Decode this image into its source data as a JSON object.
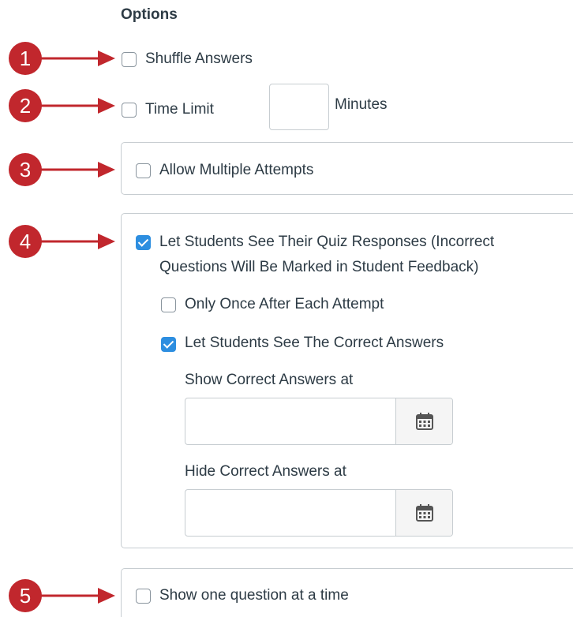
{
  "section": {
    "title": "Options"
  },
  "options": {
    "shuffle_answers": {
      "label": "Shuffle Answers",
      "checked": false
    },
    "time_limit": {
      "label": "Time Limit",
      "checked": false,
      "value": "",
      "unit_label": "Minutes"
    },
    "allow_multiple_attempts": {
      "label": "Allow Multiple Attempts",
      "checked": false
    },
    "see_responses": {
      "label_line1": "Let Students See Their Quiz Responses (Incorrect",
      "label_line2": "Questions Will Be Marked in Student Feedback)",
      "checked": true,
      "only_once": {
        "label": "Only Once After Each Attempt",
        "checked": false
      },
      "see_correct": {
        "label": "Let Students See The Correct Answers",
        "checked": true
      },
      "show_correct_at": {
        "label": "Show Correct Answers at",
        "value": ""
      },
      "hide_correct_at": {
        "label": "Hide Correct Answers at",
        "value": ""
      }
    },
    "one_question": {
      "label": "Show one question at a time",
      "checked": false
    }
  },
  "callouts": [
    "1",
    "2",
    "3",
    "4",
    "5"
  ],
  "colors": {
    "callout": "#c1272d",
    "checkbox_checked": "#2d8ee0",
    "text": "#2d3b45",
    "border": "#c7cdd1"
  },
  "icons": {
    "calendar": "calendar-icon",
    "checkmark": "checkmark-icon",
    "arrow": "arrow-right-icon"
  }
}
